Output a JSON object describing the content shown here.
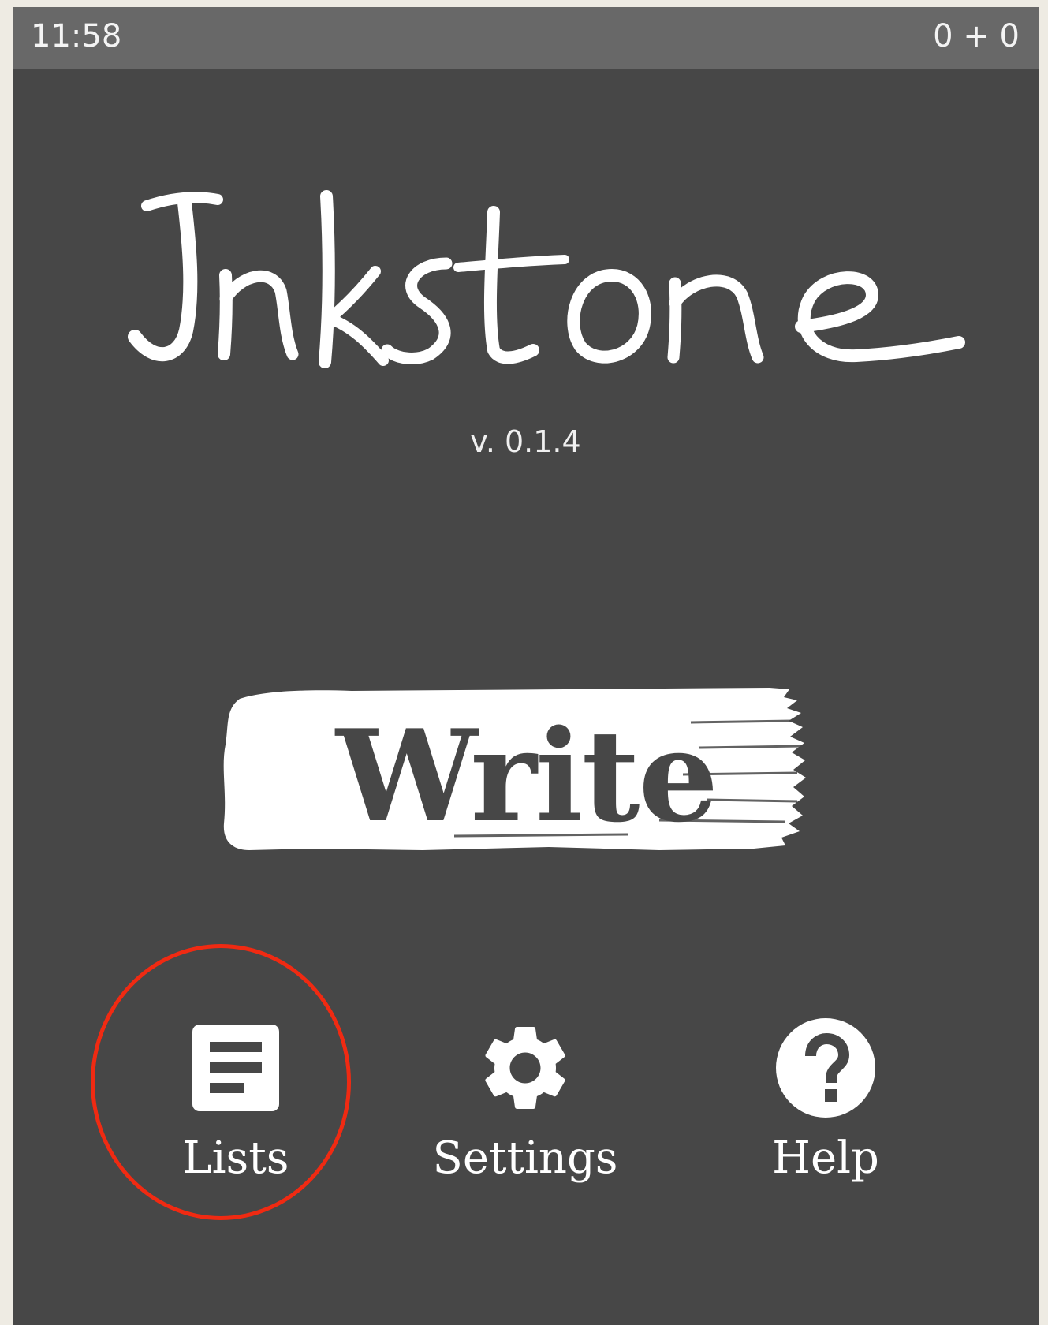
{
  "status_bar": {
    "time": "11:58",
    "counter": "0 + 0"
  },
  "app": {
    "name": "Inkstone",
    "version": "v. 0.1.4"
  },
  "main": {
    "write_label": "Write"
  },
  "nav": {
    "items": [
      {
        "label": "Lists",
        "icon": "list-icon"
      },
      {
        "label": "Settings",
        "icon": "gear-icon"
      },
      {
        "label": "Help",
        "icon": "help-icon"
      }
    ]
  },
  "annotation": {
    "highlight_color": "#f02a12",
    "highlighted_item": "Lists"
  },
  "colors": {
    "background": "#474747",
    "status_bar": "#686868",
    "foreground": "#ffffff",
    "page": "#eeebe3"
  }
}
